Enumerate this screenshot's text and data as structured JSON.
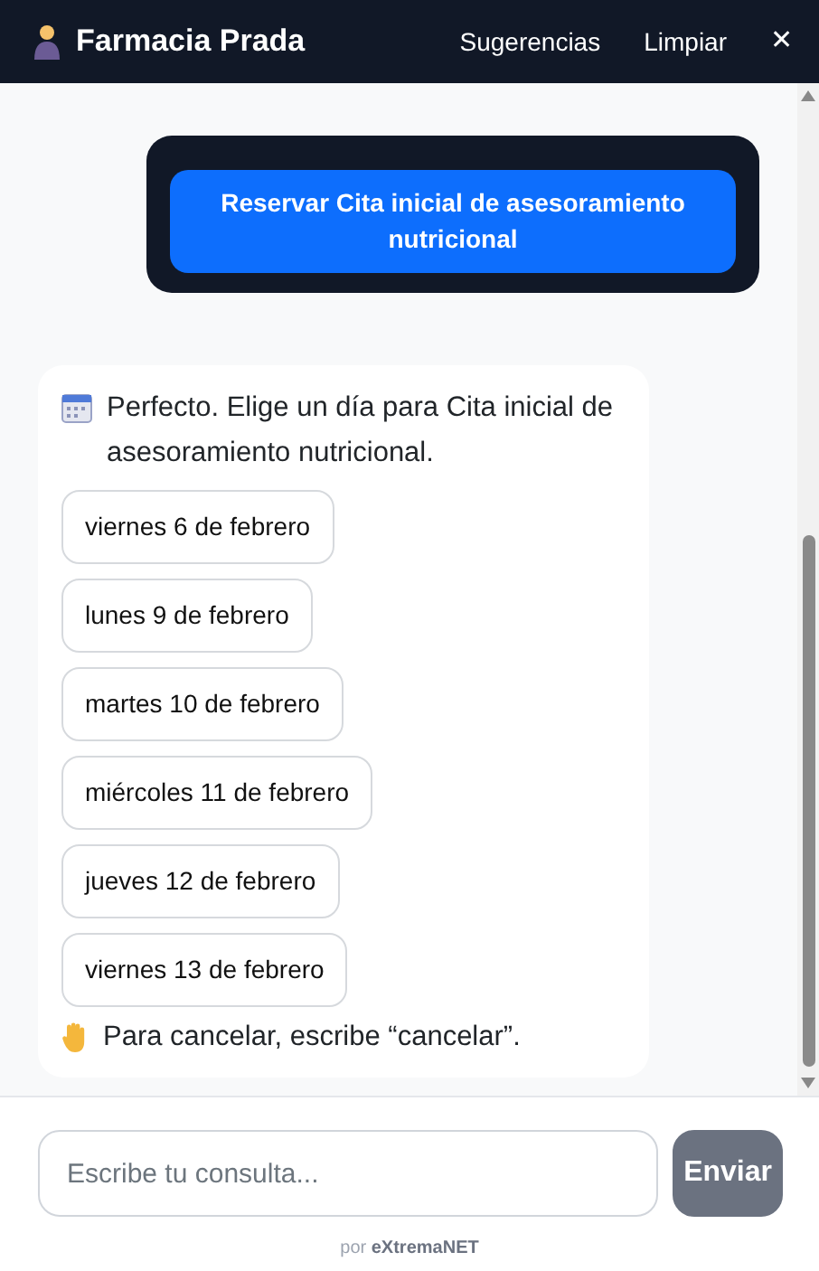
{
  "header": {
    "title": "Farmacia Prada",
    "actions": [
      {
        "label": "Sugerencias"
      },
      {
        "label": "Limpiar"
      }
    ],
    "close": "✕"
  },
  "messages": [
    {
      "kind": "user",
      "button": "Reservar Cita inicial de asesoramiento nutricional"
    },
    {
      "kind": "bot",
      "text": "Perfecto. Elige un día para Cita inicial de asesoramiento nutricional.",
      "options": [
        "viernes 6 de febrero",
        "lunes 9 de febrero",
        "martes 10 de febrero",
        "miércoles 11 de febrero",
        "jueves 12 de febrero",
        "viernes 13 de febrero"
      ],
      "note": "Para cancelar, escribe “cancelar”."
    }
  ],
  "composer": {
    "placeholder": "Escribe tu consulta...",
    "send": "Enviar",
    "send_disabled": true
  },
  "footer": "por **eXtremaNET**"
}
